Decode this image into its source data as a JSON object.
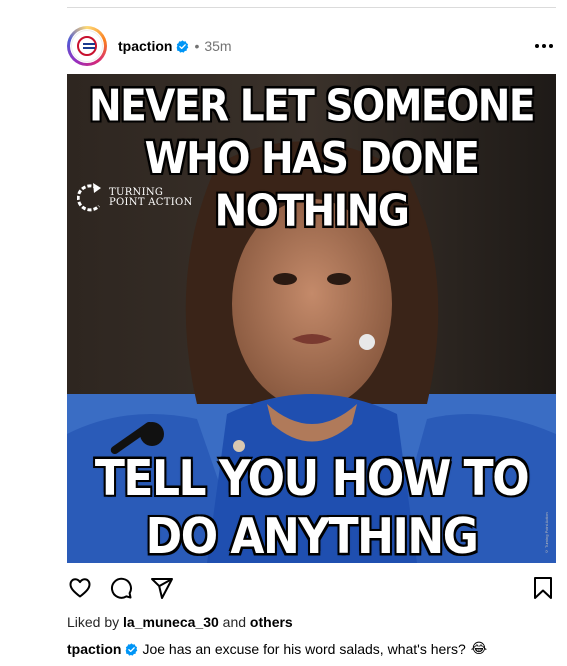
{
  "post": {
    "username": "tpaction",
    "separator": "•",
    "time": "35m",
    "avatar_label": "TURNING POINT ACTION",
    "more_icon": "more-horizontal-icon",
    "verified_icon": "verified-badge-icon"
  },
  "image": {
    "top_text": "NEVER LET SOMEONE WHO HAS DONE NOTHING",
    "bottom_text": "TELL YOU HOW TO DO ANYTHING",
    "brand_line1": "TURNING",
    "brand_line2": "POINT ACTION",
    "side_credit": "© Turning Point Action"
  },
  "actions": {
    "like_icon": "heart-icon",
    "comment_icon": "comment-icon",
    "share_icon": "send-icon",
    "save_icon": "bookmark-icon"
  },
  "likes": {
    "prefix": "Liked by ",
    "user": "la_muneca_30",
    "middle": " and ",
    "others": "others"
  },
  "caption": {
    "user": "tpaction",
    "text": "Joe has an excuse for his word salads, what's hers?",
    "emoji": "😂"
  },
  "colors": {
    "verified": "#0095f6",
    "secondary_text": "#737373",
    "divider": "#dbdbdb"
  }
}
